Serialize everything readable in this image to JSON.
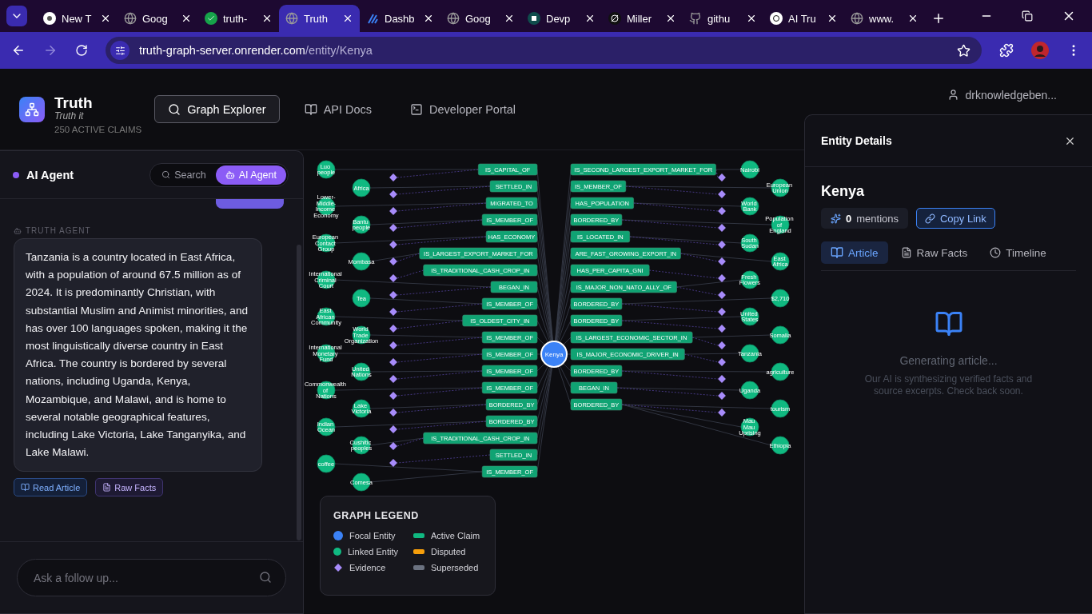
{
  "browser": {
    "tabs": [
      {
        "title": "New T",
        "selected": false
      },
      {
        "title": "Goog",
        "selected": false
      },
      {
        "title": "truth-",
        "selected": false
      },
      {
        "title": "Truth",
        "selected": true
      },
      {
        "title": "Dashb",
        "selected": false
      },
      {
        "title": "Goog",
        "selected": false
      },
      {
        "title": "Devp",
        "selected": false
      },
      {
        "title": "Miller",
        "selected": false
      },
      {
        "title": "githu",
        "selected": false
      },
      {
        "title": "AI Tru",
        "selected": false
      },
      {
        "title": "www.",
        "selected": false
      }
    ],
    "url_host": "truth-graph-server.onrender.com",
    "url_path": "/entity/Kenya"
  },
  "header": {
    "title": "Truth",
    "tagline": "Truth it",
    "claims": "250 ACTIVE CLAIMS",
    "nav": [
      {
        "label": "Graph Explorer",
        "selected": true
      },
      {
        "label": "API Docs",
        "selected": false
      },
      {
        "label": "Developer Portal",
        "selected": false
      }
    ],
    "user": "drknowledgeben..."
  },
  "agent_panel": {
    "title": "AI Agent",
    "modes": [
      {
        "label": "Search",
        "selected": false
      },
      {
        "label": "AI Agent",
        "selected": true
      }
    ],
    "sender": "TRUTH AGENT",
    "message": "Tanzania is a country located in East Africa, with a population of around 67.5 million as of 2024. It is predominantly Christian, with substantial Muslim and Animist minorities, and has over 100 languages spoken, making it the most linguistically diverse country in East Africa. The country is bordered by several nations, including Uganda, Kenya, Mozambique, and Malawi, and is home to several notable geographical features, including Lake Victoria, Lake Tanganyika, and Lake Malawi.",
    "actions": [
      {
        "label": "Read Article",
        "kind": "article"
      },
      {
        "label": "Raw Facts",
        "kind": "facts"
      }
    ],
    "input_placeholder": "Ask a follow up..."
  },
  "graph": {
    "focal": "Kenya",
    "entities": [
      "Luo people",
      "Nairobi",
      "Africa",
      "European Union",
      "Lower-Middle-Income Economy",
      "World Bank",
      "Bantu people",
      "Population of England",
      "European Contact Group",
      "South Sudan",
      "Mombasa",
      "East Africa",
      "International Criminal Court",
      "Fresh Flowers",
      "Tea",
      "$2,710",
      "East African Community",
      "United States",
      "World Trade Organization",
      "Somalia",
      "International Monetary Fund",
      "Tanzania",
      "United Nations",
      "agriculture",
      "Commonwealth of Nations",
      "Uganda",
      "Lake Victoria",
      "tourism",
      "Indian Ocean",
      "Mau Mau Uprising",
      "Cushitic peoples",
      "Ethiopia",
      "coffee",
      "Comesa"
    ],
    "relations": [
      "IS_CAPITAL_OF",
      "IS_SECOND_LARGEST_EXPORT_MARKET_FOR",
      "SETTLED_IN",
      "IS_MEMBER_OF",
      "MIGRATED_TO",
      "HAS_POPULATION",
      "IS_MEMBER_OF",
      "BORDERED_BY",
      "HAS_ECONOMY",
      "IS_LOCATED_IN",
      "IS_LARGEST_EXPORT_MARKET_FOR",
      "ARE_FAST_GROWING_EXPORT_IN",
      "IS_TRADITIONAL_CASH_CROP_IN",
      "HAS_PER_CAPITA_GNI",
      "BEGAN_IN",
      "IS_MAJOR_NON_NATO_ALLY_OF",
      "IS_MEMBER_OF",
      "BORDERED_BY",
      "IS_OLDEST_CITY_IN",
      "BORDERED_BY",
      "IS_MEMBER_OF",
      "IS_LARGEST_ECONOMIC_SECTOR_IN",
      "IS_MEMBER_OF",
      "IS_MAJOR_ECONOMIC_DRIVER_IN",
      "IS_MEMBER_OF",
      "BORDERED_BY",
      "IS_MEMBER_OF",
      "BEGAN_IN",
      "BORDERED_BY",
      "BORDERED_BY",
      "BORDERED_BY",
      "IS_TRADITIONAL_CASH_CROP_IN",
      "SETTLED_IN",
      "IS_MEMBER_OF"
    ]
  },
  "legend": {
    "title": "GRAPH LEGEND",
    "items": [
      {
        "label": "Focal Entity",
        "kind": "focal"
      },
      {
        "label": "Active Claim",
        "kind": "active"
      },
      {
        "label": "Linked Entity",
        "kind": "linked"
      },
      {
        "label": "Disputed",
        "kind": "disputed"
      },
      {
        "label": "Evidence",
        "kind": "evidence"
      },
      {
        "label": "Superseded",
        "kind": "superseded"
      }
    ]
  },
  "details": {
    "title": "Entity Details",
    "entity": "Kenya",
    "mentions_count": "0",
    "mentions_label": "mentions",
    "copy_link": "Copy Link",
    "tabs": [
      {
        "label": "Article",
        "selected": true
      },
      {
        "label": "Raw Facts",
        "selected": false
      },
      {
        "label": "Timeline",
        "selected": false
      }
    ],
    "status_title": "Generating article...",
    "status_text": "Our AI is synthesizing verified facts and source excerpts. Check back soon."
  }
}
